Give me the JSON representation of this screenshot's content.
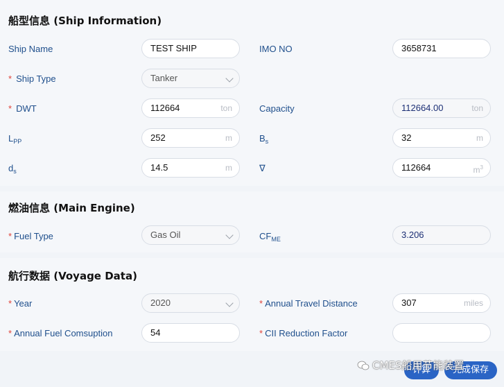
{
  "ship_info": {
    "title": "船型信息 (Ship Information)",
    "ship_name_label": "Ship Name",
    "ship_name_value": "TEST SHIP",
    "imo_label": "IMO NO",
    "imo_value": "3658731",
    "ship_type_label": "Ship Type",
    "ship_type_value": "Tanker",
    "dwt_label": "DWT",
    "dwt_value": "112664",
    "dwt_unit": "ton",
    "capacity_label": "Capacity",
    "capacity_value": "112664.00",
    "capacity_unit": "ton",
    "lpp_label_main": "L",
    "lpp_label_sub": "PP",
    "lpp_value": "252",
    "lpp_unit": "m",
    "bs_label_main": "B",
    "bs_label_sub": "s",
    "bs_value": "32",
    "bs_unit": "m",
    "ds_label_main": "d",
    "ds_label_sub": "s",
    "ds_value": "14.5",
    "ds_unit": "m",
    "nabla_label": "∇",
    "nabla_value": "112664",
    "nabla_unit_main": "m",
    "nabla_unit_sup": "3"
  },
  "main_engine": {
    "title": "燃油信息 (Main Engine)",
    "fuel_type_label": "Fuel Type",
    "fuel_type_value": "Gas Oil",
    "cf_label_main": "CF",
    "cf_label_sub": "ME",
    "cf_value": "3.206"
  },
  "voyage": {
    "title": "航行数据 (Voyage Data)",
    "year_label": "Year",
    "year_value": "2020",
    "distance_label": "Annual Travel Distance",
    "distance_value": "307",
    "distance_unit": "miles",
    "fuel_consumption_label": "Annual Fuel Comsuption",
    "fuel_consumption_value": "54",
    "cii_label": "CII Reduction Factor",
    "cii_value": ""
  },
  "required_mark": "*",
  "buttons": {
    "calculate": "计算",
    "save": "完成保存"
  },
  "watermark": "CMES船用节能装置"
}
